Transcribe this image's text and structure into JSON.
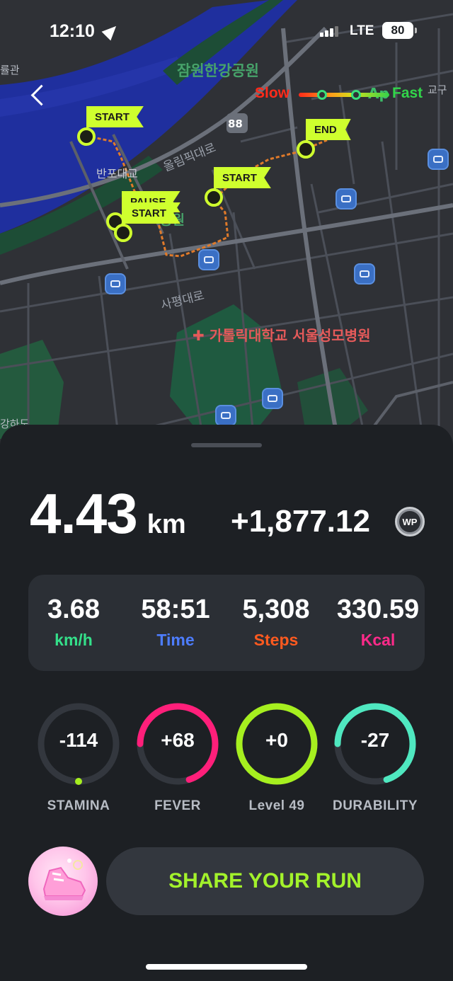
{
  "status_bar": {
    "time": "12:10",
    "network": "LTE",
    "battery": "80"
  },
  "map": {
    "labels": {
      "park_north": "잠원한강공원",
      "bridge": "반포대교",
      "road_upper": "올림픽대로",
      "road_lower": "사평대로",
      "park_mid": "공원",
      "hospital": "가톨릭대학교 서울성모병원",
      "route_shield": "88",
      "edge_left_top": "률관",
      "edge_right_top": "교구",
      "edge_bottom_left": "강하도",
      "park_north_suffix": "Ap"
    },
    "speed_legend": {
      "slow": "Slow",
      "fast": "Fast",
      "slow_color": "#ff2a1a",
      "fast_color": "#32d44a"
    },
    "flags": {
      "start": "START",
      "pause": "PAUSE",
      "end": "END"
    }
  },
  "run": {
    "distance": "4.43",
    "distance_unit": "km",
    "points": "+1,877.12",
    "points_badge": "WP"
  },
  "stats": [
    {
      "value": "3.68",
      "label": "km/h",
      "color": "#34e08a"
    },
    {
      "value": "58:51",
      "label": "Time",
      "color": "#4d7dff"
    },
    {
      "value": "5,308",
      "label": "Steps",
      "color": "#ff5a1f"
    },
    {
      "value": "330.59",
      "label": "Kcal",
      "color": "#ff2a8a"
    }
  ],
  "rings": [
    {
      "value": "-114",
      "label": "STAMINA",
      "color": "#a6ef1f",
      "level": 0.0
    },
    {
      "value": "+68",
      "label": "FEVER",
      "color": "#ff1f7a",
      "level": 0.7
    },
    {
      "value": "+0",
      "label": "Level 49",
      "color": "#a6ef1f",
      "level": 1.0
    },
    {
      "value": "-27",
      "label": "DURABILITY",
      "color": "#4fe8c0",
      "level": 0.7
    }
  ],
  "share": {
    "label": "SHARE YOUR RUN"
  }
}
